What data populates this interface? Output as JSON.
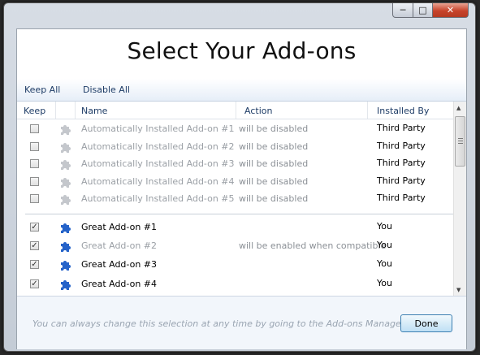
{
  "window": {
    "buttons": {
      "minimize_icon": "minimize-icon",
      "maximize_icon": "maximize-icon",
      "close_icon": "close-icon"
    }
  },
  "title": "Select Your Add-ons",
  "toolbar": {
    "keep_all": "Keep All",
    "disable_all": "Disable All"
  },
  "columns": {
    "keep": "Keep",
    "name": "Name",
    "action": "Action",
    "installed_by": "Installed By"
  },
  "addons": [
    {
      "checked": false,
      "name": "Automatically Installed Add-on #1",
      "action": "will be disabled",
      "installed_by": "Third Party",
      "icon": "puzzle-piece-gray-icon",
      "dim": true
    },
    {
      "checked": false,
      "name": "Automatically Installed Add-on #2",
      "action": "will be disabled",
      "installed_by": "Third Party",
      "icon": "puzzle-piece-gray-icon",
      "dim": true
    },
    {
      "checked": false,
      "name": "Automatically Installed Add-on #3",
      "action": "will be disabled",
      "installed_by": "Third Party",
      "icon": "puzzle-piece-gray-icon",
      "dim": true
    },
    {
      "checked": false,
      "name": "Automatically Installed Add-on #4",
      "action": "will be disabled",
      "installed_by": "Third Party",
      "icon": "puzzle-piece-gray-icon",
      "dim": true
    },
    {
      "checked": false,
      "name": "Automatically Installed Add-on #5",
      "action": "will be disabled",
      "installed_by": "Third Party",
      "icon": "puzzle-piece-gray-icon",
      "dim": true
    },
    {
      "checked": true,
      "name": "Great Add-on #1",
      "action": "",
      "installed_by": "You",
      "icon": "puzzle-piece-blue-icon",
      "dim": false
    },
    {
      "checked": true,
      "name": "Great Add-on #2",
      "action": "will be enabled when compatible",
      "installed_by": "You",
      "icon": "puzzle-piece-blue-icon",
      "dim": true
    },
    {
      "checked": true,
      "name": "Great Add-on #3",
      "action": "",
      "installed_by": "You",
      "icon": "puzzle-piece-blue-icon",
      "dim": false
    },
    {
      "checked": true,
      "name": "Great Add-on #4",
      "action": "",
      "installed_by": "You",
      "icon": "puzzle-piece-blue-icon",
      "dim": false
    }
  ],
  "footer": {
    "message": "You can always change this selection at any time by going to the Add-ons Manager",
    "done": "Done"
  },
  "colors": {
    "accent_blue": "#2563c9",
    "muted_text": "#9a9fa5",
    "toolbar_text": "#1e3c66"
  }
}
